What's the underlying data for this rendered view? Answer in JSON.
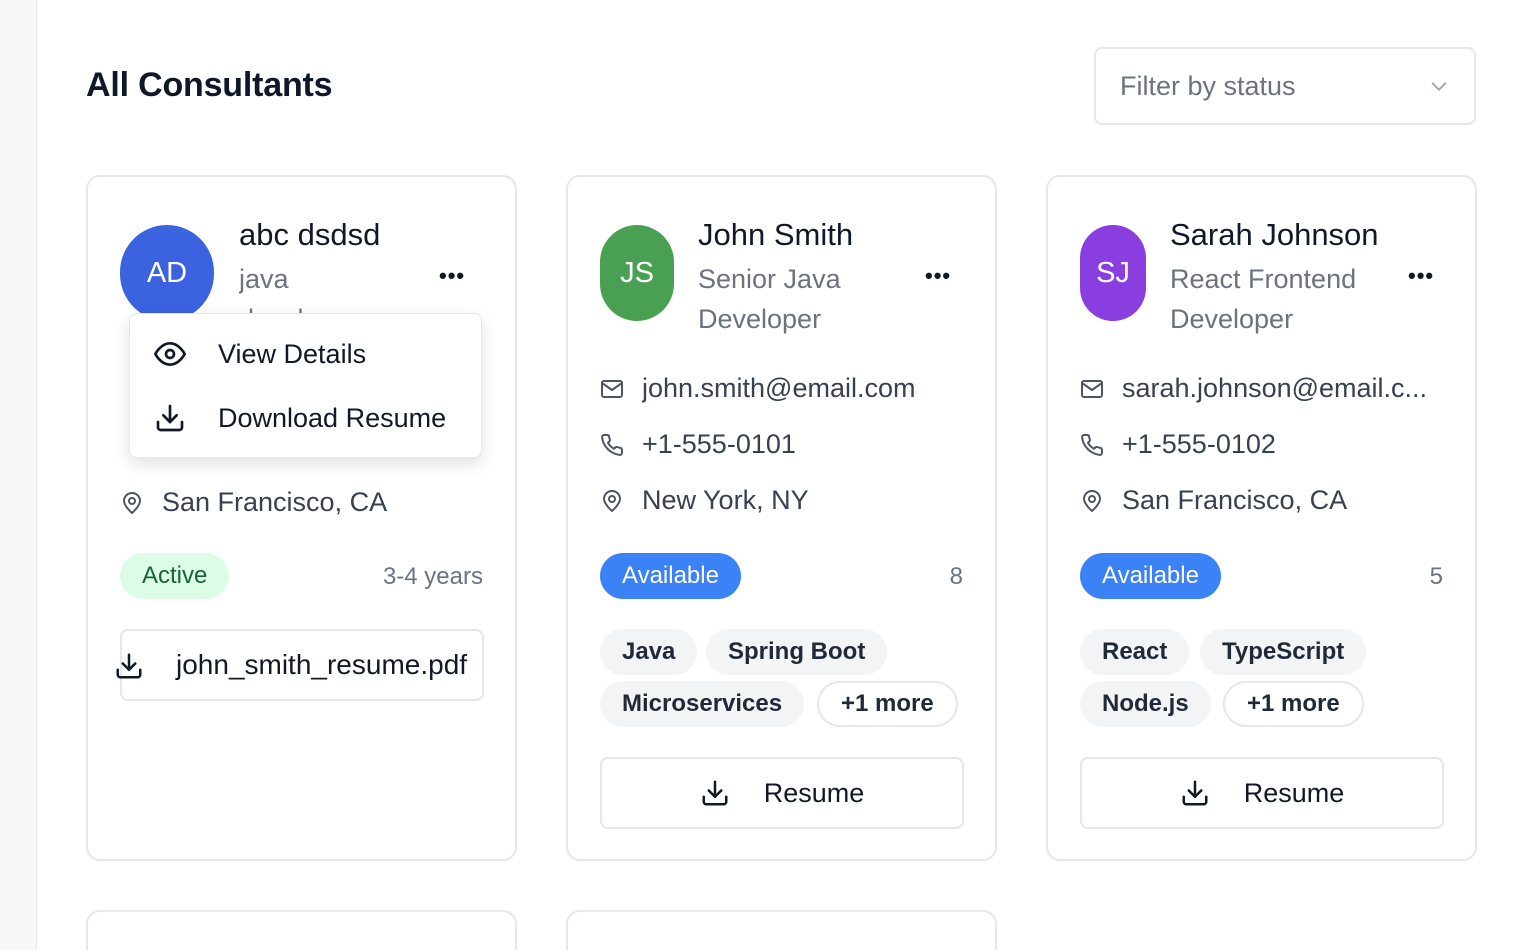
{
  "page": {
    "title": "All Consultants"
  },
  "filter": {
    "placeholder": "Filter by status",
    "icon": "chevron-down-icon"
  },
  "consultants": [
    {
      "initials": "AD",
      "name": "abc dsdsd",
      "role_line1": "java",
      "role_line2": "developer",
      "avatar_color": "#3b63e0",
      "location": "San Francisco, CA",
      "status": "Active",
      "experience": "3-4 years",
      "resume_file": "john_smith_resume.pdf"
    },
    {
      "initials": "JS",
      "name": "John Smith",
      "role_line1": "Senior Java",
      "role_line2": "Developer",
      "avatar_color": "#4aa052",
      "email": "john.smith@email.com",
      "phone": "+1-555-0101",
      "location": "New York, NY",
      "status": "Available",
      "experience": "8",
      "skills": [
        "Java",
        "Spring Boot",
        "Microservices",
        "+1 more"
      ],
      "resume_label": "Resume"
    },
    {
      "initials": "SJ",
      "name": "Sarah Johnson",
      "role_line1": "React Frontend",
      "role_line2": "Developer",
      "avatar_color": "#8a3ee0",
      "email": "sarah.johnson@email.c...",
      "phone": "+1-555-0102",
      "location": "San Francisco, CA",
      "status": "Available",
      "experience": "5",
      "skills": [
        "React",
        "TypeScript",
        "Node.js",
        "+1 more"
      ],
      "resume_label": "Resume"
    }
  ],
  "action_menu": {
    "items": [
      {
        "label": "View Details",
        "icon": "eye-icon"
      },
      {
        "label": "Download Resume",
        "icon": "download-icon"
      }
    ]
  },
  "colors": {
    "available": "#3b82f6",
    "active_bg": "#dcfce7",
    "active_text": "#166534"
  }
}
